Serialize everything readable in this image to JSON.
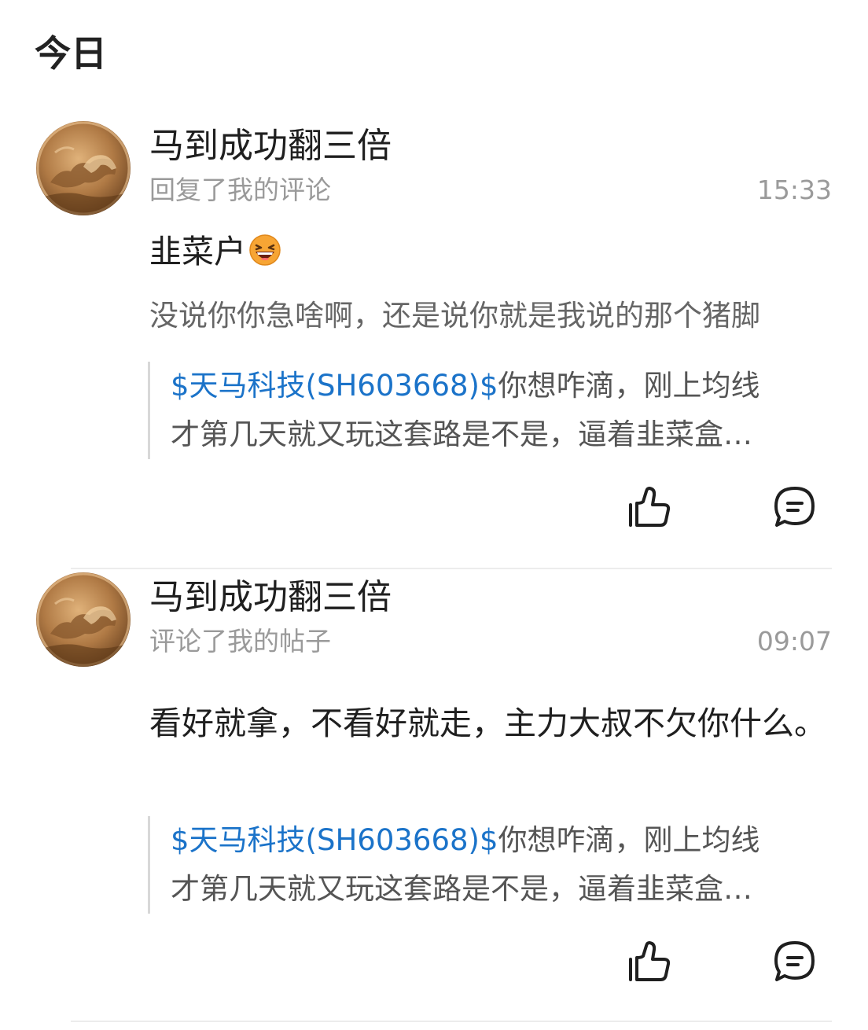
{
  "section_title": "今日",
  "notifications": [
    {
      "username": "马到成功翻三倍",
      "action": "回复了我的评论",
      "time": "15:33",
      "reply_text": "韭菜户",
      "reply_emoji": "laughing-emoji-icon",
      "my_comment": "没说你你急啥啊，还是说你就是我说的那个猪脚",
      "quote": {
        "stock": "$天马科技(SH603668)$",
        "text_line1": "你想咋滴，刚上均线",
        "text_line2": "才第几天就又玩这套路是不是，逼着韭菜盒…"
      }
    },
    {
      "username": "马到成功翻三倍",
      "action": "评论了我的帖子",
      "time": "09:07",
      "reply_text": "看好就拿，不看好就走，主力大叔不欠你什么。",
      "quote": {
        "stock": "$天马科技(SH603668)$",
        "text_line1": "你想咋滴，刚上均线",
        "text_line2": "才第几天就又玩这套路是不是，逼着韭菜盒…"
      }
    }
  ],
  "colors": {
    "link": "#1b73c9",
    "secondary_text": "#9a9a9a",
    "primary_text": "#1f1f1f",
    "divider": "#ececec"
  },
  "icons": {
    "like": "thumbs-up-icon",
    "comment": "comment-bubble-icon",
    "avatar": "gold-coin-horse-avatar"
  }
}
